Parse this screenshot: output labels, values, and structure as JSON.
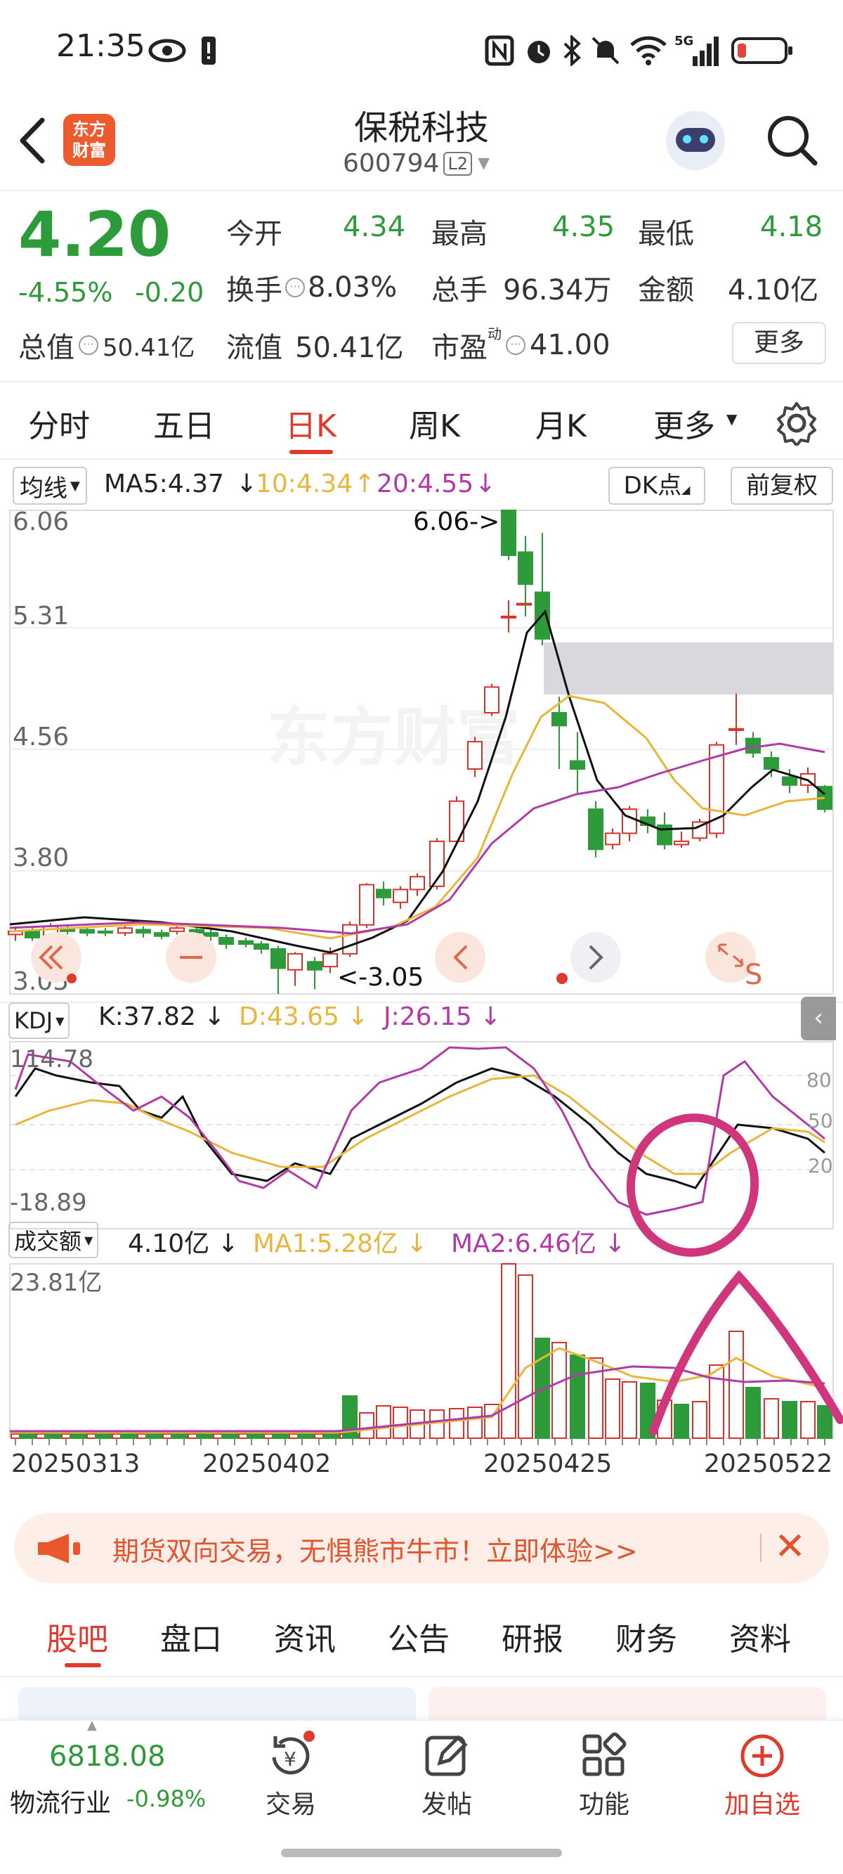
{
  "status_bar": {
    "time": "21:35",
    "icons": [
      "eye-icon",
      "alert-icon",
      "nfc-icon",
      "alarm-icon",
      "bluetooth-icon",
      "mute-icon",
      "wifi-icon",
      "5g-signal-icon",
      "battery-icon"
    ]
  },
  "header": {
    "title": "保税科技",
    "code": "600794",
    "level": "L2",
    "logo_text1": "东方",
    "logo_text2": "财富"
  },
  "quote": {
    "price": "4.20",
    "change_pct": "-4.55%",
    "change": "-0.20",
    "open_label": "今开",
    "open": "4.34",
    "high_label": "最高",
    "high": "4.35",
    "low_label": "最低",
    "low": "4.18",
    "turnover_label": "换手",
    "turnover": "8.03%",
    "volume_label": "总手",
    "volume": "96.34万",
    "amount_label": "金额",
    "amount": "4.10亿",
    "mktcap_label": "总值",
    "mktcap": "50.41亿",
    "float_label": "流值",
    "float": "50.41亿",
    "pe_label": "市盈",
    "pe_sup": "动",
    "pe": "41.00",
    "more": "更多"
  },
  "tabs": [
    "分时",
    "五日",
    "日K",
    "周K",
    "月K",
    "更多"
  ],
  "ma_bar": {
    "select": "均线",
    "ma5": "MA5:4.37",
    "ma10": "10:4.34",
    "ma20": "20:4.55",
    "dk": "DK点",
    "fq": "前复权"
  },
  "kdj_bar": {
    "select": "KDJ",
    "k": "K:37.82",
    "d": "D:43.65",
    "j": "J:26.15",
    "lv80": "80",
    "lv50": "50",
    "lv20": "20"
  },
  "vol_bar": {
    "select": "成交额",
    "v": "4.10亿",
    "ma1": "MA1:5.28亿",
    "ma2": "MA2:6.46亿"
  },
  "chart_data": {
    "type": "candlestick",
    "price_ticks": [
      "6.06",
      "5.31",
      "4.56",
      "3.80",
      "3.05"
    ],
    "max_label": "6.06->",
    "min_label": "<-3.05",
    "kdj_ticks": [
      "114.78",
      "-18.89"
    ],
    "vol_tick": "23.81亿",
    "dates": [
      "20250313",
      "20250402",
      "20250425",
      "20250522"
    ],
    "colors": {
      "up": "#d8322b",
      "down": "#2e9b3a",
      "ma5": "#111111",
      "ma10": "#e8b63a",
      "ma20": "#b23aa8"
    }
  },
  "promo": {
    "text": "期货双向交易，无惧熊市牛市！立即体验>>"
  },
  "sub_tabs": [
    "股吧",
    "盘口",
    "资讯",
    "公告",
    "研报",
    "财务",
    "资料"
  ],
  "bottom": {
    "index_value": "6818.08",
    "sector": "物流行业",
    "sector_pct": "-0.98%",
    "trade": "交易",
    "post": "发帖",
    "func": "功能",
    "add": "加自选"
  }
}
